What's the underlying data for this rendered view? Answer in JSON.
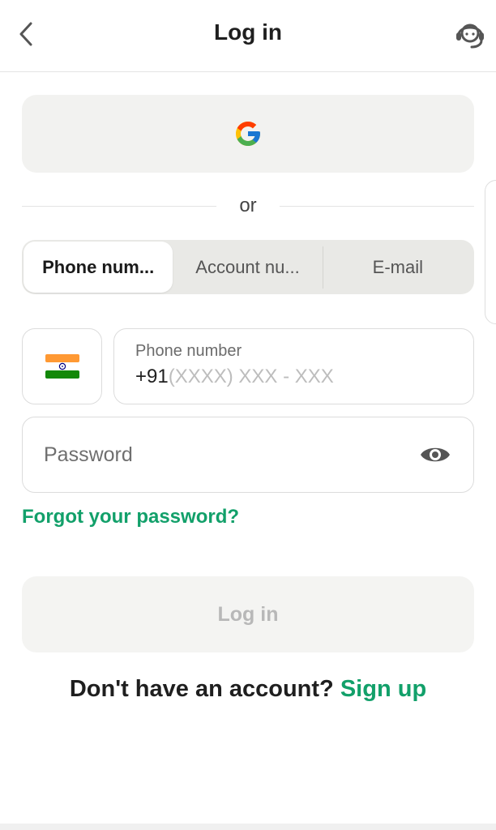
{
  "header": {
    "title": "Log in",
    "back_icon": "chevron-left-icon",
    "support_icon": "headset-support-icon"
  },
  "google": {
    "icon": "google-icon",
    "colors": {
      "blue": "#4285F4",
      "red": "#EA4335",
      "yellow": "#FBBC05",
      "green": "#34A853"
    }
  },
  "divider": {
    "text": "or"
  },
  "tabs": [
    {
      "label": "Phone num...",
      "active": true
    },
    {
      "label": "Account nu...",
      "active": false
    },
    {
      "label": "E-mail",
      "active": false
    }
  ],
  "phone": {
    "country_flag_icon": "india-flag-icon",
    "label": "Phone number",
    "code": "+91",
    "value": "",
    "placeholder": "(XXXX) XXX - XXX"
  },
  "password": {
    "value": "",
    "placeholder": "Password",
    "toggle_icon": "eye-icon"
  },
  "forgot": {
    "label": "Forgot your password?"
  },
  "login_button": {
    "label": "Log in"
  },
  "signup": {
    "prompt": "Don't have an account?",
    "link": "Sign up"
  },
  "colors": {
    "accent": "#12a06a",
    "field_border": "#dcdcdc",
    "button_bg": "#f2f2f0",
    "disabled_text": "#b8b8b8"
  }
}
